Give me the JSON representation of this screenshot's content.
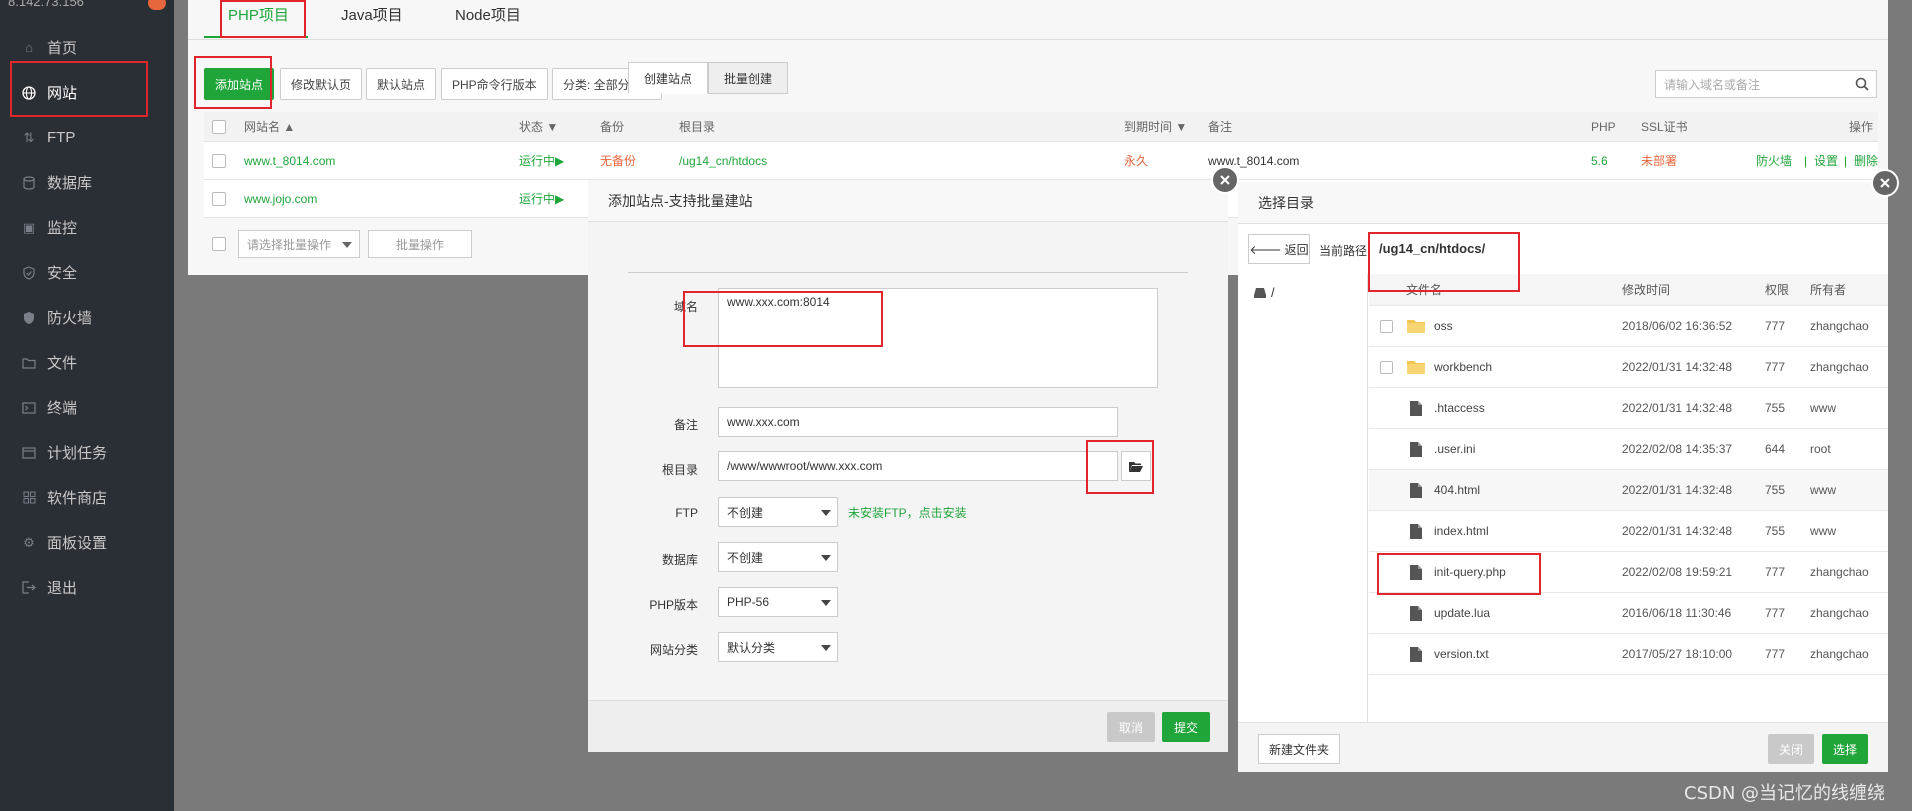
{
  "sidebar": {
    "ip_text": "8.142.73.156",
    "badge": "",
    "items": [
      {
        "label": "首页",
        "icon": "home-icon"
      },
      {
        "label": "网站",
        "icon": "globe-icon"
      },
      {
        "label": "FTP",
        "icon": "ftp-icon"
      },
      {
        "label": "数据库",
        "icon": "database-icon"
      },
      {
        "label": "监控",
        "icon": "monitor-icon"
      },
      {
        "label": "安全",
        "icon": "shield-check-icon"
      },
      {
        "label": "防火墙",
        "icon": "firewall-icon"
      },
      {
        "label": "文件",
        "icon": "folder-icon"
      },
      {
        "label": "终端",
        "icon": "terminal-icon"
      },
      {
        "label": "计划任务",
        "icon": "calendar-icon"
      },
      {
        "label": "软件商店",
        "icon": "grid-icon"
      },
      {
        "label": "面板设置",
        "icon": "gear-icon"
      },
      {
        "label": "退出",
        "icon": "logout-icon"
      }
    ]
  },
  "project_tabs": [
    "PHP项目",
    "Java项目",
    "Node项目"
  ],
  "toolbar": {
    "add_site": "添加站点",
    "edit_default_page": "修改默认页",
    "default_site": "默认站点",
    "php_cli_version": "PHP命令行版本",
    "category": "分类: 全部分类",
    "search_placeholder": "请输入域名或备注"
  },
  "site_table": {
    "headers": {
      "name": "网站名 ▲",
      "status": "状态 ▼",
      "backup": "备份",
      "root": "根目录",
      "expire": "到期时间 ▼",
      "remark": "备注",
      "php": "PHP",
      "ssl": "SSL证书",
      "ops": "操作"
    },
    "rows": [
      {
        "name": "www.t_8014.com",
        "status": "运行中▶",
        "backup": "无备份",
        "root": "/ug14_cn/htdocs",
        "expire": "永久",
        "remark": "www.t_8014.com",
        "php": "5.6",
        "ssl": "未部署",
        "op_firewall": "防火墙",
        "op_settings": "设置",
        "op_delete": "删除"
      },
      {
        "name": "www.jojo.com",
        "status": "运行中▶"
      }
    ],
    "batch_placeholder": "请选择批量操作",
    "batch_button": "批量操作"
  },
  "add_dialog": {
    "title": "添加站点-支持批量建站",
    "tab_create": "创建站点",
    "tab_batch": "批量创建",
    "domain_label": "域名",
    "domain_value": "www.xxx.com:8014",
    "remark_label": "备注",
    "remark_value": "www.xxx.com",
    "root_label": "根目录",
    "root_value": "/www/wwwroot/www.xxx.com",
    "ftp_label": "FTP",
    "ftp_value": "不创建",
    "ftp_hint": "未安装FTP，点击安装",
    "db_label": "数据库",
    "db_value": "不创建",
    "php_label": "PHP版本",
    "php_value": "PHP-56",
    "category_label": "网站分类",
    "category_value": "默认分类",
    "cancel": "取消",
    "submit": "提交"
  },
  "dir_dialog": {
    "title": "选择目录",
    "back": "返回",
    "current_path_label": "当前路径:",
    "current_path": "/ug14_cn/htdocs/",
    "root_node": "/",
    "headers": {
      "name": "文件名",
      "mtime": "修改时间",
      "perm": "权限",
      "owner": "所有者"
    },
    "files": [
      {
        "name": "oss",
        "mtime": "2018/06/02 16:36:52",
        "perm": "777",
        "owner": "zhangchao",
        "type": "folder"
      },
      {
        "name": "workbench",
        "mtime": "2022/01/31 14:32:48",
        "perm": "777",
        "owner": "zhangchao",
        "type": "folder"
      },
      {
        "name": ".htaccess",
        "mtime": "2022/01/31 14:32:48",
        "perm": "755",
        "owner": "www",
        "type": "file"
      },
      {
        "name": ".user.ini",
        "mtime": "2022/02/08 14:35:37",
        "perm": "644",
        "owner": "root",
        "type": "file"
      },
      {
        "name": "404.html",
        "mtime": "2022/01/31 14:32:48",
        "perm": "755",
        "owner": "www",
        "type": "file"
      },
      {
        "name": "index.html",
        "mtime": "2022/01/31 14:32:48",
        "perm": "755",
        "owner": "www",
        "type": "file"
      },
      {
        "name": "init-query.php",
        "mtime": "2022/02/08 19:59:21",
        "perm": "777",
        "owner": "zhangchao",
        "type": "file"
      },
      {
        "name": "update.lua",
        "mtime": "2016/06/18 11:30:46",
        "perm": "777",
        "owner": "zhangchao",
        "type": "file"
      },
      {
        "name": "version.txt",
        "mtime": "2017/05/27 18:10:00",
        "perm": "777",
        "owner": "zhangchao",
        "type": "file"
      }
    ],
    "new_folder": "新建文件夹",
    "close": "关闭",
    "choose": "选择"
  },
  "watermark": "CSDN @当记忆的线缠绕",
  "colors": {
    "accent": "#20a53a",
    "sidebar": "#2a2e35",
    "annotation": "#e0252b",
    "warning": "#e8663c"
  }
}
